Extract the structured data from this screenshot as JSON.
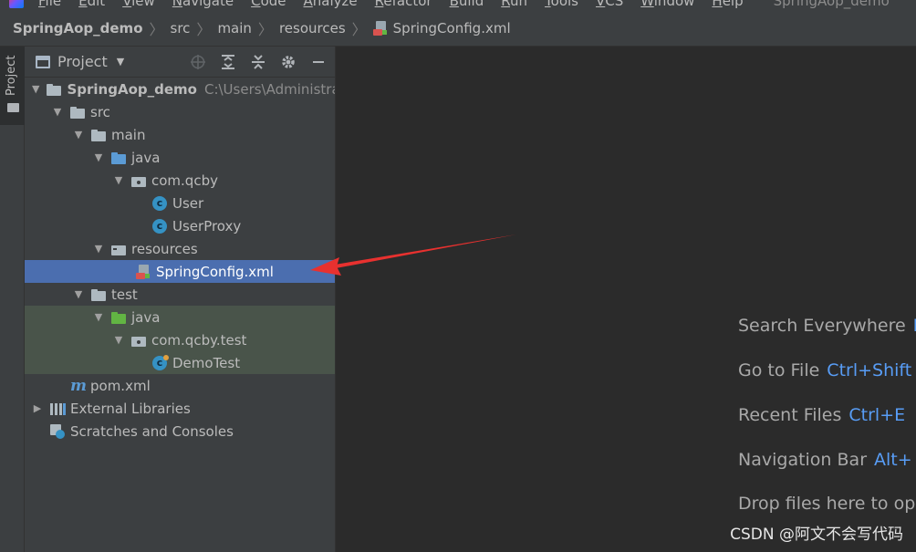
{
  "menu": {
    "items": [
      "File",
      "Edit",
      "View",
      "Navigate",
      "Code",
      "Analyze",
      "Refactor",
      "Build",
      "Run",
      "Tools",
      "VCS",
      "Window",
      "Help"
    ],
    "window_title": "SpringAop_demo"
  },
  "breadcrumb": {
    "project": "SpringAop_demo",
    "src": "src",
    "main": "main",
    "resources": "resources",
    "file": "SpringConfig.xml"
  },
  "stripe": {
    "project_tab": "Project"
  },
  "panel": {
    "title": "Project"
  },
  "tree": {
    "root": {
      "name": "SpringAop_demo",
      "path": "C:\\Users\\Administrat"
    },
    "src": "src",
    "main": "main",
    "main_java": "java",
    "pkg": "com.qcby",
    "user": "User",
    "user_proxy": "UserProxy",
    "resources": "resources",
    "spring_config": "SpringConfig.xml",
    "test": "test",
    "test_java": "java",
    "test_pkg": "com.qcby.test",
    "demo_test": "DemoTest",
    "pom": "pom.xml",
    "external_libraries": "External Libraries",
    "scratches": "Scratches and Consoles"
  },
  "editor_hints": [
    {
      "label": "Search Everywhere",
      "key": "D"
    },
    {
      "label": "Go to File",
      "key": "Ctrl+Shift"
    },
    {
      "label": "Recent Files",
      "key": "Ctrl+E"
    },
    {
      "label": "Navigation Bar",
      "key": "Alt+"
    },
    {
      "label": "Drop files here to op",
      "key": ""
    }
  ],
  "watermark": "CSDN @阿文不会写代码",
  "colors": {
    "selection": "#4b6eaf",
    "shortcut": "#589df6",
    "annotation_arrow": "#e8312f"
  }
}
